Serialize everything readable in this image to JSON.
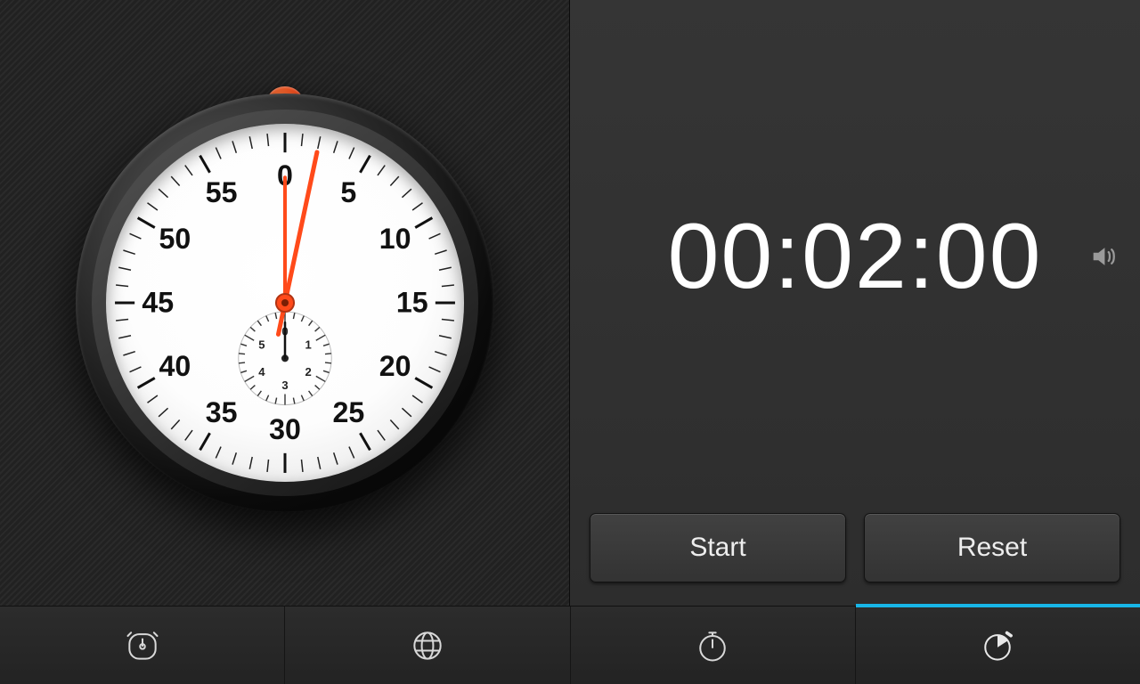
{
  "timer": {
    "display": "00:02:00",
    "minutes": 2,
    "seconds": 0,
    "hand_second_angle_deg": 12,
    "hand_minute_angle_deg": 0,
    "start_label": "Start",
    "reset_label": "Reset",
    "sound_icon": "speaker-icon"
  },
  "dial": {
    "major_numbers": [
      "0",
      "5",
      "10",
      "15",
      "20",
      "25",
      "30",
      "35",
      "40",
      "45",
      "50",
      "55"
    ],
    "subdial_numbers": [
      "0",
      "1",
      "2",
      "3",
      "4",
      "5"
    ]
  },
  "tabs": [
    {
      "id": "alarm",
      "icon": "alarm-clock-icon",
      "active": false
    },
    {
      "id": "world",
      "icon": "globe-icon",
      "active": false
    },
    {
      "id": "stopwatch",
      "icon": "stopwatch-icon",
      "active": false
    },
    {
      "id": "timer",
      "icon": "timer-icon",
      "active": true
    }
  ],
  "colors": {
    "accent": "#ff4a1a",
    "tab_highlight": "#18b6e8"
  }
}
